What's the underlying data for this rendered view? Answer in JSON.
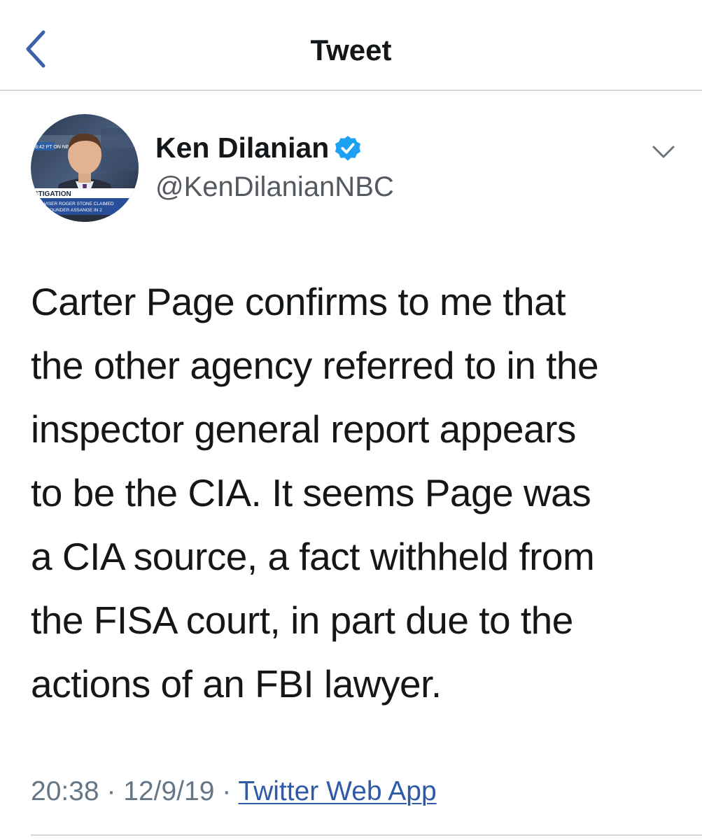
{
  "header": {
    "title": "Tweet",
    "back_icon": "chevron-left-icon"
  },
  "author": {
    "name": "Ken Dilanian",
    "handle": "@KenDilanianNBC",
    "verified": true,
    "verified_icon": "verified-badge-icon"
  },
  "avatar": {
    "banner_lines": [
      "STIGATION",
      "P ADVISER ROGER STONE CLAIMED",
      "EAKS FOUNDER ASSANGE IN 2"
    ],
    "network_label": "8:42 PT ON NBC"
  },
  "tweet": {
    "lines": [
      "Carter Page confirms to me that",
      "the other agency referred to in the",
      "inspector general report appears",
      "to be the CIA.  It seems Page was",
      "a CIA source, a fact withheld from",
      "the FISA court, in part due to the",
      "actions of an FBI lawyer."
    ]
  },
  "meta": {
    "time": "20:38",
    "separator": "·",
    "date": "12/9/19",
    "source": "Twitter Web App"
  },
  "colors": {
    "accent": "#1da1f2",
    "link": "#2f5aa8",
    "back_arrow": "#3b62a8",
    "text": "#14171a",
    "muted": "#657786"
  }
}
